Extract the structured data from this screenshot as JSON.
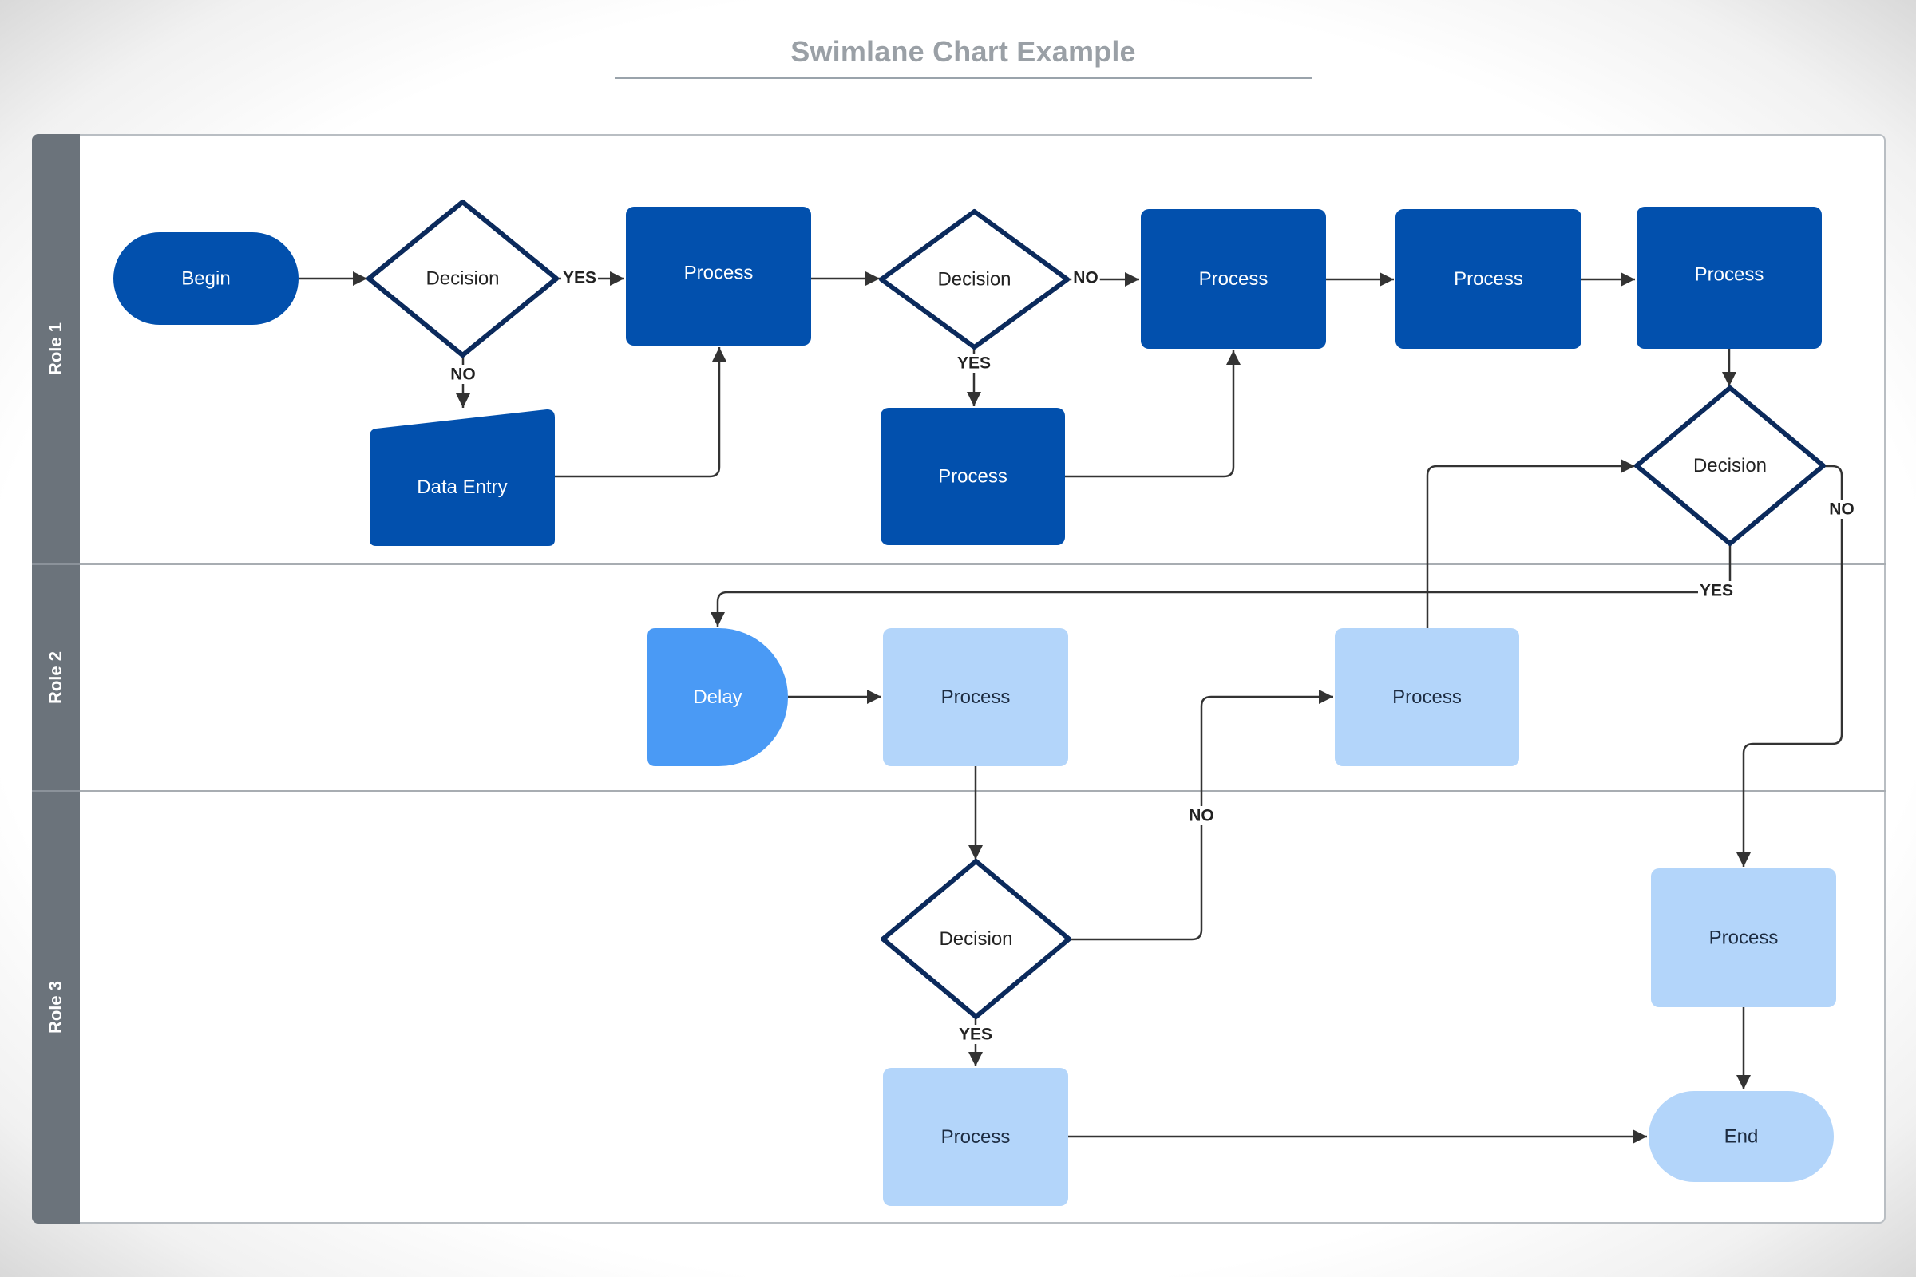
{
  "title": "Swimlane Chart Example",
  "colors": {
    "role1_fill": "#0250ad",
    "role1_text": "#ffffff",
    "delay_fill": "#4a9af5",
    "role23_fill": "#b3d5fa",
    "role23_text": "#1c2b40",
    "decision_stroke": "#0b2a5c",
    "decision_text": "#222222",
    "lane_bar": "#6b737b",
    "connector": "#333333"
  },
  "lanes": [
    {
      "id": "role1",
      "label": "Role 1"
    },
    {
      "id": "role2",
      "label": "Role 2"
    },
    {
      "id": "role3",
      "label": "Role 3"
    }
  ],
  "nodes": [
    {
      "id": "begin",
      "lane": "role1",
      "type": "terminator",
      "label": "Begin"
    },
    {
      "id": "decision1",
      "lane": "role1",
      "type": "decision",
      "label": "Decision"
    },
    {
      "id": "process1",
      "lane": "role1",
      "type": "process",
      "label": "Process"
    },
    {
      "id": "data_entry",
      "lane": "role1",
      "type": "manual-input",
      "label": "Data Entry"
    },
    {
      "id": "decision2",
      "lane": "role1",
      "type": "decision",
      "label": "Decision"
    },
    {
      "id": "process_yes",
      "lane": "role1",
      "type": "process",
      "label": "Process"
    },
    {
      "id": "process2",
      "lane": "role1",
      "type": "process",
      "label": "Process"
    },
    {
      "id": "process3",
      "lane": "role1",
      "type": "process",
      "label": "Process"
    },
    {
      "id": "process4",
      "lane": "role1",
      "type": "process",
      "label": "Process"
    },
    {
      "id": "decision3",
      "lane": "role1",
      "type": "decision",
      "label": "Decision"
    },
    {
      "id": "delay",
      "lane": "role2",
      "type": "delay",
      "label": "Delay"
    },
    {
      "id": "process_r2a",
      "lane": "role2",
      "type": "process",
      "label": "Process"
    },
    {
      "id": "process_r2b",
      "lane": "role2",
      "type": "process",
      "label": "Process"
    },
    {
      "id": "decision4",
      "lane": "role3",
      "type": "decision",
      "label": "Decision"
    },
    {
      "id": "process_r3a",
      "lane": "role3",
      "type": "process",
      "label": "Process"
    },
    {
      "id": "process_r3b",
      "lane": "role3",
      "type": "process",
      "label": "Process"
    },
    {
      "id": "end",
      "lane": "role3",
      "type": "terminator",
      "label": "End"
    }
  ],
  "edges": [
    {
      "from": "begin",
      "to": "decision1",
      "label": ""
    },
    {
      "from": "decision1",
      "to": "process1",
      "label": "YES"
    },
    {
      "from": "decision1",
      "to": "data_entry",
      "label": "NO"
    },
    {
      "from": "data_entry",
      "to": "process1",
      "label": ""
    },
    {
      "from": "process1",
      "to": "decision2",
      "label": ""
    },
    {
      "from": "decision2",
      "to": "process2",
      "label": "NO"
    },
    {
      "from": "decision2",
      "to": "process_yes",
      "label": "YES"
    },
    {
      "from": "process_yes",
      "to": "process2",
      "label": ""
    },
    {
      "from": "process2",
      "to": "process3",
      "label": ""
    },
    {
      "from": "process3",
      "to": "process4",
      "label": ""
    },
    {
      "from": "process4",
      "to": "decision3",
      "label": ""
    },
    {
      "from": "decision3",
      "to": "delay",
      "label": "YES"
    },
    {
      "from": "decision3",
      "to": "process_r3b",
      "label": "NO"
    },
    {
      "from": "delay",
      "to": "process_r2a",
      "label": ""
    },
    {
      "from": "process_r2a",
      "to": "decision4",
      "label": ""
    },
    {
      "from": "decision4",
      "to": "process_r2b",
      "label": "NO"
    },
    {
      "from": "decision4",
      "to": "process_r3a",
      "label": "YES"
    },
    {
      "from": "process_r2b",
      "to": "decision3",
      "label": ""
    },
    {
      "from": "process_r3a",
      "to": "end",
      "label": ""
    },
    {
      "from": "process_r3b",
      "to": "end",
      "label": ""
    }
  ]
}
